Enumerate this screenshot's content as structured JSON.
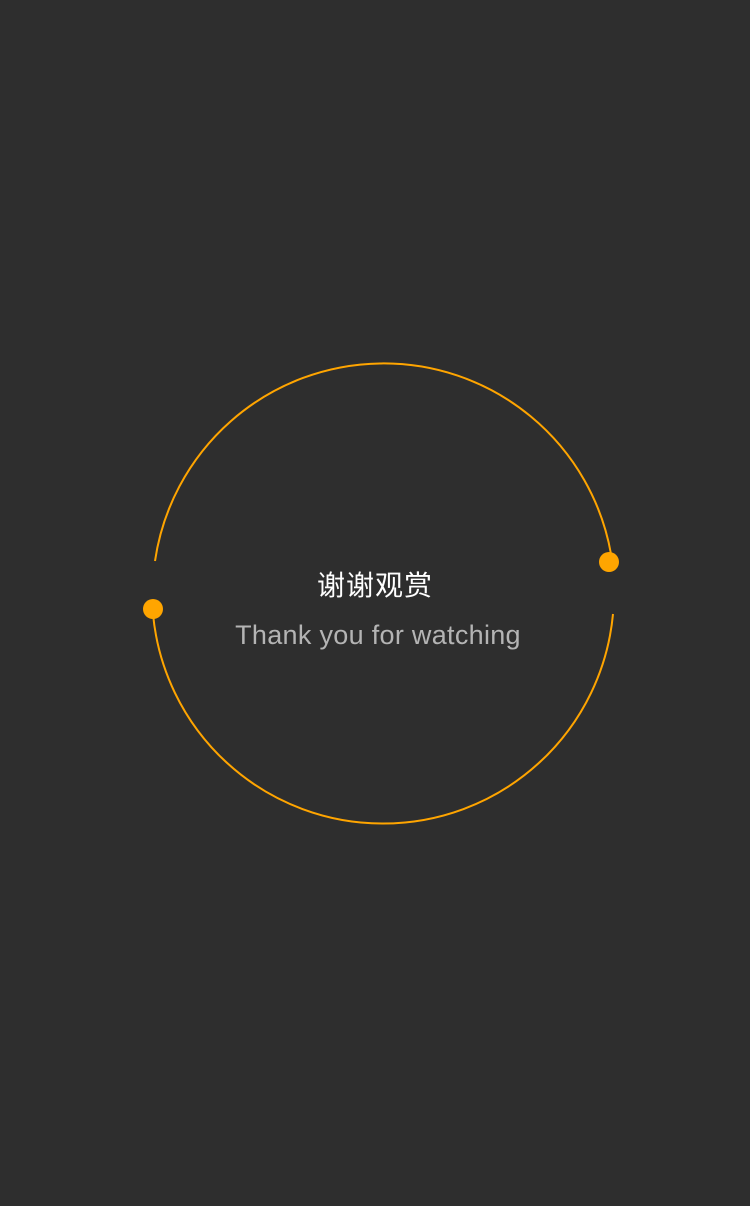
{
  "slide": {
    "title_cn": "谢谢观赏",
    "title_en": "Thank you for watching"
  },
  "colors": {
    "background": "#2e2e2e",
    "accent": "#ffa500",
    "title_cn": "#ffffff",
    "title_en": "#b4b4b4"
  }
}
